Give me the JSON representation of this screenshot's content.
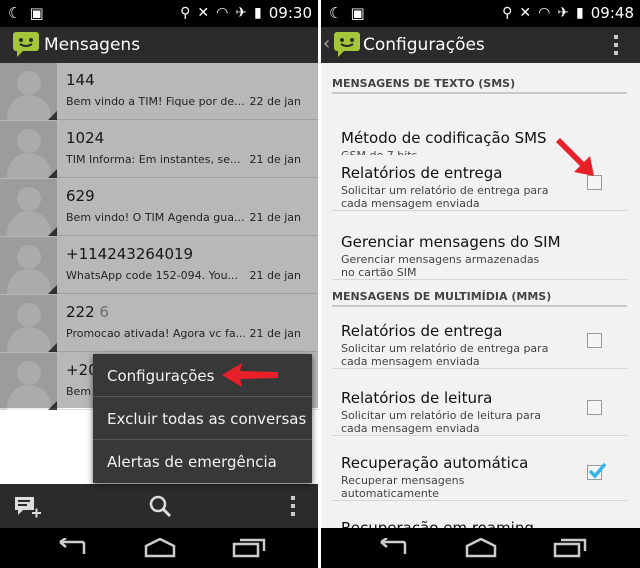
{
  "left": {
    "status_time": "09:30",
    "app_title": "Mensagens",
    "conversations": [
      {
        "name": "144",
        "count": "",
        "snippet": "Bem vindo a TIM! Fique por de...",
        "date": "22 de jan"
      },
      {
        "name": "1024",
        "count": "",
        "snippet": "TIM Informa: Em instantes, se...",
        "date": "21 de jan"
      },
      {
        "name": "629",
        "count": "",
        "snippet": "Bem vindo! O TIM Agenda gua...",
        "date": "21 de jan"
      },
      {
        "name": "+114243264019",
        "count": "",
        "snippet": "WhatsApp code 152-094. You...",
        "date": "21 de jan"
      },
      {
        "name": "222",
        "count": "6",
        "snippet": "Promocao ativada! Agora vc fa...",
        "date": "21 de jan"
      },
      {
        "name": "+20",
        "count": "",
        "snippet": "Bem",
        "date": ""
      }
    ],
    "menu": [
      "Configurações",
      "Excluir todas as conversas",
      "Alertas de emergência"
    ]
  },
  "right": {
    "status_time": "09:48",
    "app_title": "Configurações",
    "sections": [
      {
        "header": "MENSAGENS DE TEXTO (SMS)",
        "prefs": [
          {
            "title": "Método de codificação SMS",
            "summary": "GSM de 7 bits",
            "checkbox": null
          },
          {
            "title": "Relatórios de entrega",
            "summary": "Solicitar um relatório de entrega para cada mensagem enviada",
            "checkbox": false
          },
          {
            "title": "Gerenciar mensagens do SIM",
            "summary": "Gerenciar mensagens armazenadas no cartão SIM",
            "checkbox": null
          }
        ]
      },
      {
        "header": "MENSAGENS DE MULTIMÍDIA (MMS)",
        "prefs": [
          {
            "title": "Relatórios de entrega",
            "summary": "Solicitar um relatório de entrega para cada mensagem enviada",
            "checkbox": false
          },
          {
            "title": "Relatórios de leitura",
            "summary": "Solicitar um relatório de leitura para cada mensagem enviada",
            "checkbox": false
          },
          {
            "title": "Recuperação automática",
            "summary": "Recuperar mensagens automaticamente",
            "checkbox": true
          },
          {
            "title": "Recuperação em roaming",
            "summary": "",
            "checkbox": null
          }
        ]
      }
    ]
  },
  "colors": {
    "accent": "#33b5e5",
    "android_green": "#a4c639",
    "arrow_red": "#e8202a"
  }
}
